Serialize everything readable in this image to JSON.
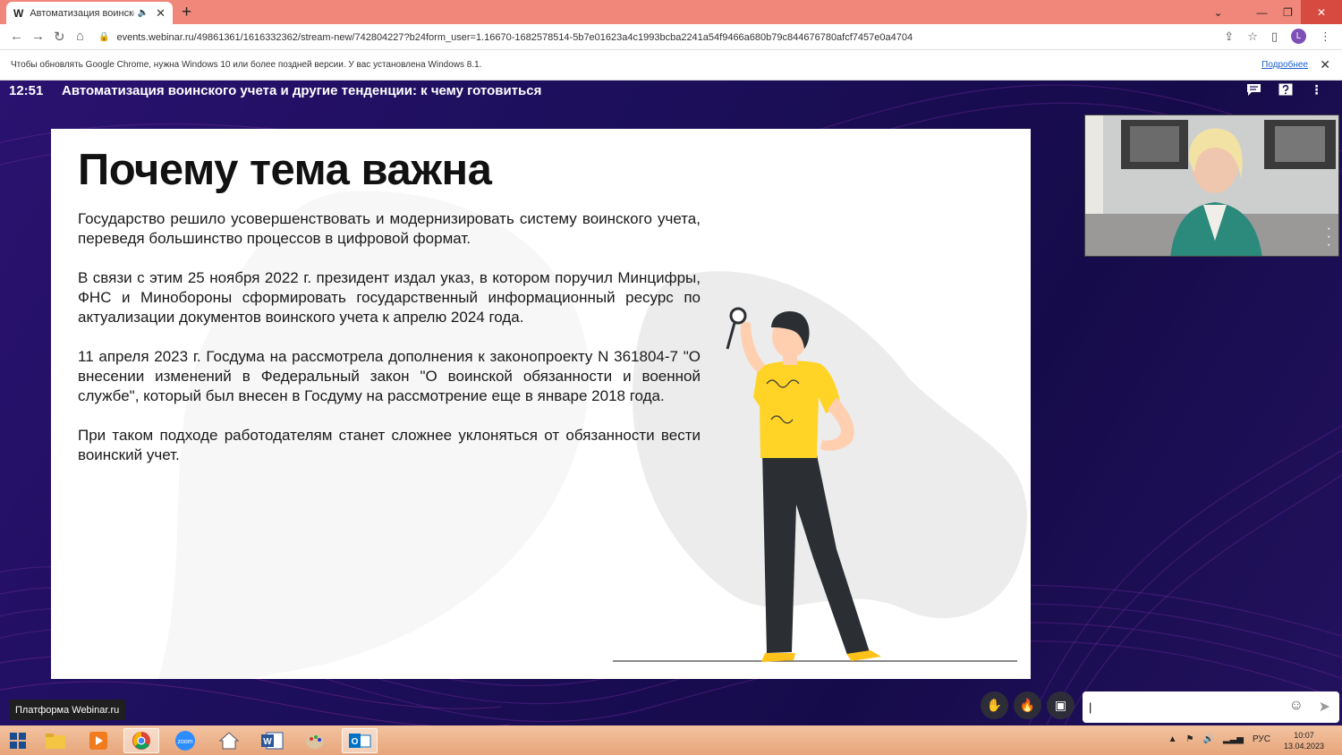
{
  "browser": {
    "tab_title": "Автоматизация воинского у",
    "tab_favicon": "W",
    "url": "events.webinar.ru/49861361/1616332362/stream-new/742804227?b24form_user=1.16670-1682578514-5b7e01623a4c1993bcba2241a54f9466a680b79c844676780afcf7457e0a4704",
    "profile_letter": "L",
    "info_message": "Чтобы обновлять Google Chrome, нужна Windows 10 или более поздней версии. У вас установлена Windows 8.1.",
    "info_link": "Подробнее"
  },
  "webinar": {
    "time": "12:51",
    "title": "Автоматизация воинского учета и другие тенденции: к чему готовиться",
    "platform_badge": "Платформа Webinar.ru",
    "chat_input_value": "|"
  },
  "slide": {
    "heading": "Почему тема важна",
    "paragraphs": [
      "Государство решило усовершенствовать и модернизировать систему воинского учета, переведя большинство процессов в цифровой формат.",
      "В связи с этим 25 ноября 2022 г. президент издал указ, в котором поручил Минцифры, ФНС и Минобороны сформировать государственный информационный ресурс по актуализации документов воинского учета к апрелю 2024 года.",
      "11 апреля 2023 г. Госдума на рассмотрела дополнения к законопроекту N 361804-7 \"О внесении изменений в Федеральный закон \"О воинской обязанности и военной службе\", который был внесен в Госдуму на рассмотрение еще в январе 2018 года.",
      "При таком подходе работодателям станет сложнее уклоняться от обязанности вести воинский учет."
    ]
  },
  "taskbar": {
    "lang": "РУС",
    "time": "10:07",
    "date": "13.04.2023",
    "zoom_label": "zoom"
  },
  "colors": {
    "tabbar": "#f0877a",
    "stage_bg": "#1d0f5c",
    "shirt": "#ffd426",
    "pants": "#2b2f33"
  }
}
